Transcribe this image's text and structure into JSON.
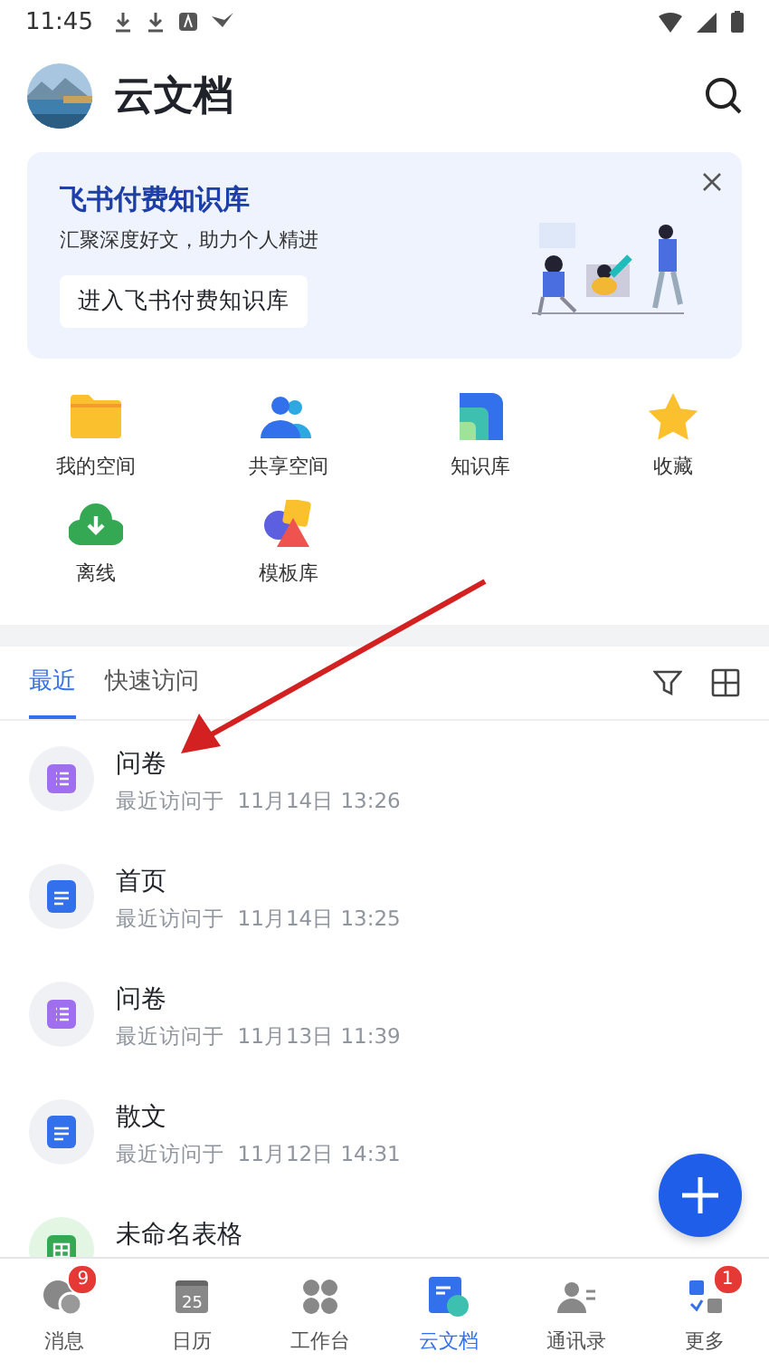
{
  "status_bar": {
    "time": "11:45"
  },
  "header": {
    "title": "云文档"
  },
  "banner": {
    "title": "飞书付费知识库",
    "subtitle": "汇聚深度好文，助力个人精进",
    "button": "进入飞书付费知识库"
  },
  "shortcuts": [
    {
      "kind": "folder",
      "label": "我的空间"
    },
    {
      "kind": "people",
      "label": "共享空间"
    },
    {
      "kind": "wiki",
      "label": "知识库"
    },
    {
      "kind": "star",
      "label": "收藏"
    },
    {
      "kind": "offline",
      "label": "离线"
    },
    {
      "kind": "template",
      "label": "模板库"
    }
  ],
  "tabs": [
    {
      "label": "最近",
      "selected": true
    },
    {
      "label": "快速访问",
      "selected": false
    }
  ],
  "files": [
    {
      "kind": "form",
      "name": "问卷",
      "subtitle": "最近访问于  11月14日 13:26"
    },
    {
      "kind": "doc",
      "name": "首页",
      "subtitle": "最近访问于  11月14日 13:25"
    },
    {
      "kind": "form",
      "name": "问卷",
      "subtitle": "最近访问于  11月13日 11:39"
    },
    {
      "kind": "doc",
      "name": "散文",
      "subtitle": "最近访问于  11月12日 14:31"
    },
    {
      "kind": "sheet",
      "name": "未命名表格"
    }
  ],
  "nav": [
    {
      "kind": "chat",
      "label": "消息",
      "badge": "9",
      "selected": false
    },
    {
      "kind": "calendar",
      "label": "日历",
      "icon_text": "25",
      "selected": false
    },
    {
      "kind": "apps",
      "label": "工作台",
      "selected": false
    },
    {
      "kind": "docs",
      "label": "云文档",
      "selected": true
    },
    {
      "kind": "contacts",
      "label": "通讯录",
      "selected": false
    },
    {
      "kind": "more",
      "label": "更多",
      "badge": "1",
      "selected": false
    }
  ]
}
